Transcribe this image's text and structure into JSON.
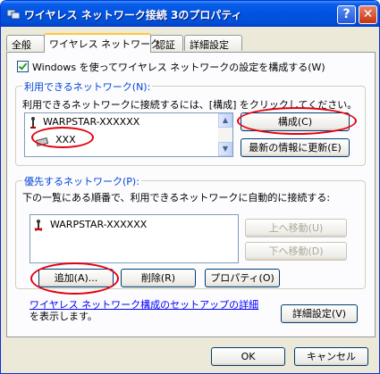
{
  "window": {
    "title": "ワイヤレス ネットワーク接続 3のプロパティ",
    "help_glyph": "?",
    "close_glyph": "✕"
  },
  "tabs": [
    "全般",
    "ワイヤレス ネットワーク",
    "認証",
    "詳細設定"
  ],
  "checkbox": {
    "label": "Windows を使ってワイヤレス ネットワークの設定を構成する(W)",
    "checked": true
  },
  "available": {
    "group_label": "利用できるネットワーク(N):",
    "description": "利用できるネットワークに接続するには、[構成] をクリックしてください。",
    "networks": [
      "WARPSTAR-XXXXXX",
      "XXX"
    ],
    "configure_button": "構成(C)",
    "refresh_button": "最新の情報に更新(E)"
  },
  "preferred": {
    "group_label": "優先するネットワーク(P):",
    "description": "下の一覧にある順番で、利用できるネットワークに自動的に接続する:",
    "networks": [
      "WARPSTAR-XXXXXX"
    ],
    "move_up_button": "上へ移動(U)",
    "move_down_button": "下へ移動(D)",
    "add_button": "追加(A)...",
    "remove_button": "削除(R)",
    "properties_button": "プロパティ(O)"
  },
  "footer": {
    "link": "ワイヤレス ネットワーク構成のセットアップの詳細",
    "link_suffix": "を表示します。",
    "advanced_button": "詳細設定(V)"
  },
  "buttons": {
    "ok": "OK",
    "cancel": "キャンセル"
  },
  "colors": {
    "title_bar": "#0054e3",
    "highlight_ring": "#e4000f",
    "group_label": "#0046d5",
    "link": "#0000ff"
  }
}
